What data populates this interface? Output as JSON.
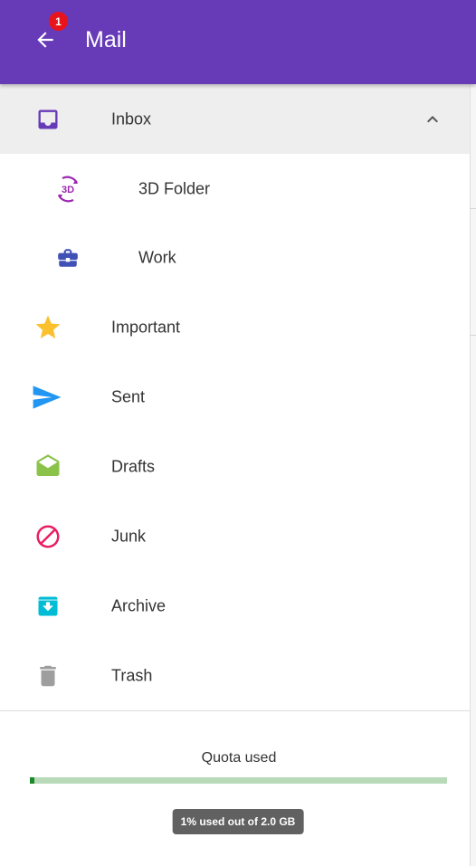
{
  "header": {
    "title": "Mail",
    "badge": "1",
    "background": "#673ab7"
  },
  "nav": {
    "inbox": {
      "label": "Inbox",
      "icon": "inbox-icon",
      "color": "#673ab7"
    },
    "folder_3d": {
      "label": "3D Folder",
      "icon": "3d-folder-icon",
      "icon_text": "3D",
      "color": "#9c27b0"
    },
    "work": {
      "label": "Work",
      "icon": "briefcase-icon",
      "color": "#3f51b5"
    },
    "important": {
      "label": "Important",
      "icon": "star-icon",
      "color": "#fbc02d"
    },
    "sent": {
      "label": "Sent",
      "icon": "send-icon",
      "color": "#2196f3"
    },
    "drafts": {
      "label": "Drafts",
      "icon": "drafts-icon",
      "color": "#8bc34a"
    },
    "junk": {
      "label": "Junk",
      "icon": "block-icon",
      "color": "#e91e63"
    },
    "archive": {
      "label": "Archive",
      "icon": "archive-icon",
      "color": "#00bcd4"
    },
    "trash": {
      "label": "Trash",
      "icon": "trash-icon",
      "color": "#9e9e9e"
    }
  },
  "quota": {
    "label": "Quota used",
    "percent": 1,
    "tooltip": "1% used out of 2.0 GB"
  }
}
